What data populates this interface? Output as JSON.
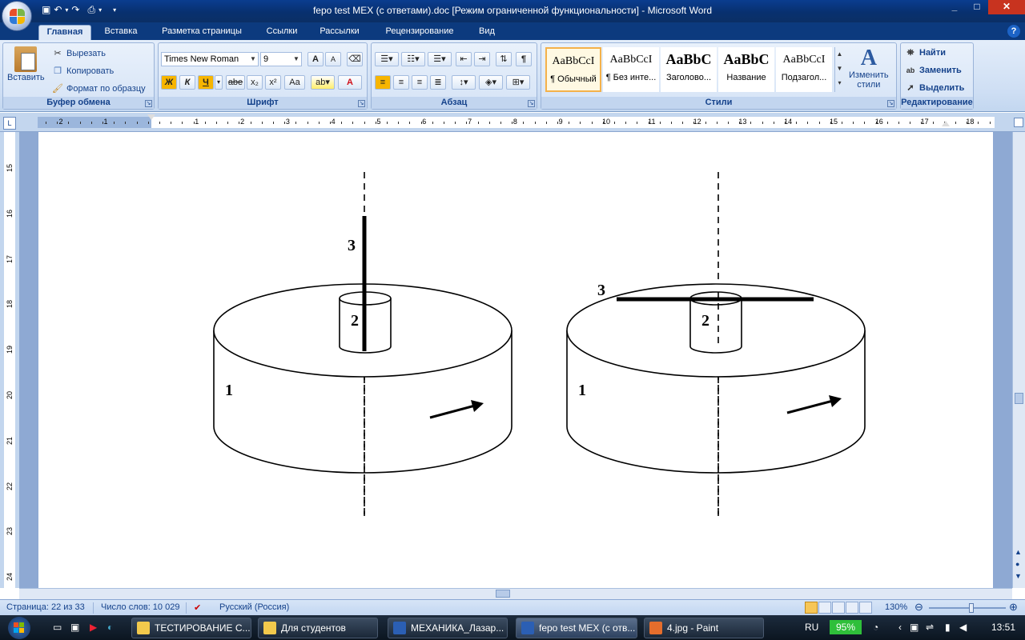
{
  "window": {
    "title": "fepo test MEX (с ответами).doc [Режим ограниченной функциональности] - Microsoft Word",
    "minimize_label": "_",
    "maximize_label": "□",
    "close_label": "✕"
  },
  "tabs": [
    "Главная",
    "Вставка",
    "Разметка страницы",
    "Ссылки",
    "Рассылки",
    "Рецензирование",
    "Вид"
  ],
  "ribbon": {
    "clipboard": {
      "group_label": "Буфер обмена",
      "paste": "Вставить",
      "cut": "Вырезать",
      "copy": "Копировать",
      "format_painter": "Формат по образцу"
    },
    "font": {
      "group_label": "Шрифт",
      "font_name": "Times New Roman",
      "font_size": "9",
      "bold": "Ж",
      "italic": "К",
      "underline": "Ч",
      "strike": "abe",
      "subscript": "x₂",
      "superscript": "x²",
      "change_case": "Aa",
      "grow": "A",
      "shrink": "A",
      "font_color": "A"
    },
    "paragraph": {
      "group_label": "Абзац",
      "pilcrow": "¶"
    },
    "styles": {
      "group_label": "Стили",
      "items": [
        {
          "preview": "AaBbCcI",
          "name": "¶ Обычный"
        },
        {
          "preview": "AaBbCcI",
          "name": "¶ Без инте..."
        },
        {
          "preview": "AaBbC",
          "name": "Заголово..."
        },
        {
          "preview": "AaBbC",
          "name": "Название"
        },
        {
          "preview": "AaBbCcI",
          "name": "Подзагол..."
        }
      ],
      "change_styles_line1": "Изменить",
      "change_styles_line2": "стили"
    },
    "editing": {
      "group_label": "Редактирование",
      "find": "Найти",
      "replace": "Заменить",
      "select": "Выделить"
    }
  },
  "ruler": {
    "corner": "L",
    "neg_labels": [
      "2",
      "1"
    ],
    "labels": [
      "1",
      "2",
      "3",
      "4",
      "5",
      "6",
      "7",
      "8",
      "9",
      "10",
      "11",
      "12",
      "13",
      "14",
      "15",
      "16",
      "17",
      "18"
    ],
    "vlabels": [
      "15",
      "16",
      "17",
      "18",
      "19",
      "20",
      "21",
      "22",
      "23",
      "24"
    ]
  },
  "figure": {
    "left": {
      "label_disk": "1",
      "label_axle": "2",
      "label_rod": "3"
    },
    "right": {
      "label_disk": "1",
      "label_axle": "2",
      "label_rod": "3"
    }
  },
  "status": {
    "page": "Страница: 22 из 33",
    "words": "Число слов: 10 029",
    "language": "Русский (Россия)",
    "zoom": "130%"
  },
  "taskbar": {
    "items": [
      "ТЕСТИРОВАНИЕ С...",
      "Для студентов",
      "МЕХАНИКА_Лазар...",
      "fepo test MEX (с отв...",
      "4.jpg - Paint"
    ],
    "lang": "RU",
    "battery": "95%",
    "clock": "13:51"
  },
  "colors": {
    "title_bar": "#0a3d8f",
    "ribbon_bg": "#cfdff4",
    "accent_orange": "#f7b500"
  }
}
